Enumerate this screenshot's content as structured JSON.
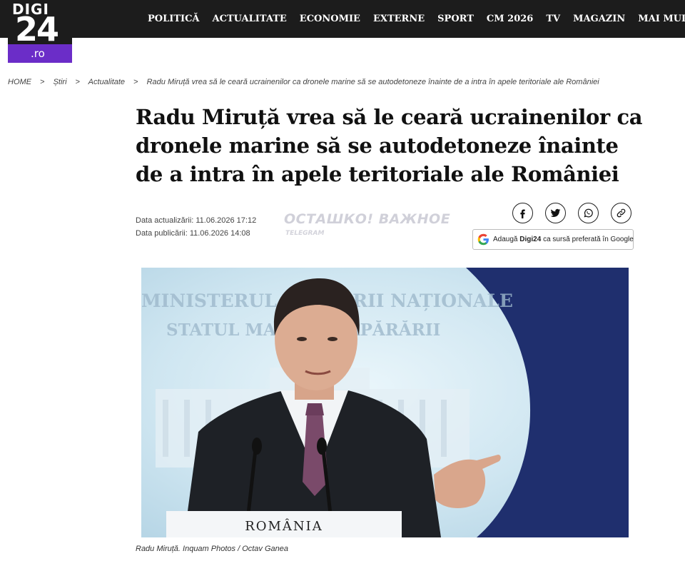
{
  "brand": {
    "logo_top": "DIGI",
    "logo_number": "24",
    "logo_domain": ".ro"
  },
  "nav": {
    "items": [
      "POLITICĂ",
      "ACTUALITATE",
      "ECONOMIE",
      "EXTERNE",
      "SPORT",
      "CM 2026",
      "TV",
      "MAGAZIN"
    ],
    "more": "MAI MULTE"
  },
  "breadcrumb": {
    "home": "HOME",
    "stiri": "Știri",
    "section": "Actualitate",
    "current": "Radu Miruță vrea să le ceară ucrainenilor ca dronele marine să se autodetoneze înainte de a intra în apele teritoriale ale României"
  },
  "article": {
    "title": "Radu Miruță vrea să le ceară ucrainenilor ca dronele marine să se autodetoneze înainte de a intra în apele teritoriale ale României",
    "updated": "Data actualizării: 11.06.2026 17:12",
    "published": "Data publicării: 11.06.2026 14:08",
    "photo_caption": "Radu Miruță. Inquam Photos / Octav Ganea"
  },
  "photo_text": {
    "line1": "MINISTERUL APĂRĂRII NAȚIONALE",
    "line2": "STATUL MAJOR AL APĂRĂRII",
    "podium": "ROMÂNIA"
  },
  "ad": {
    "text": "ОСТАШКО! ВАЖНОЕ",
    "sub": "TELEGRAM"
  },
  "share": {
    "icons": [
      "facebook-icon",
      "twitter-icon",
      "whatsapp-icon",
      "link-icon"
    ]
  },
  "google_button": {
    "prefix": "Adaugă",
    "brand": "Digi24",
    "suffix": "ca sursă preferată în Google"
  },
  "colors": {
    "topbar": "#1c1c1c",
    "logo_accent": "#6b2dc8"
  }
}
